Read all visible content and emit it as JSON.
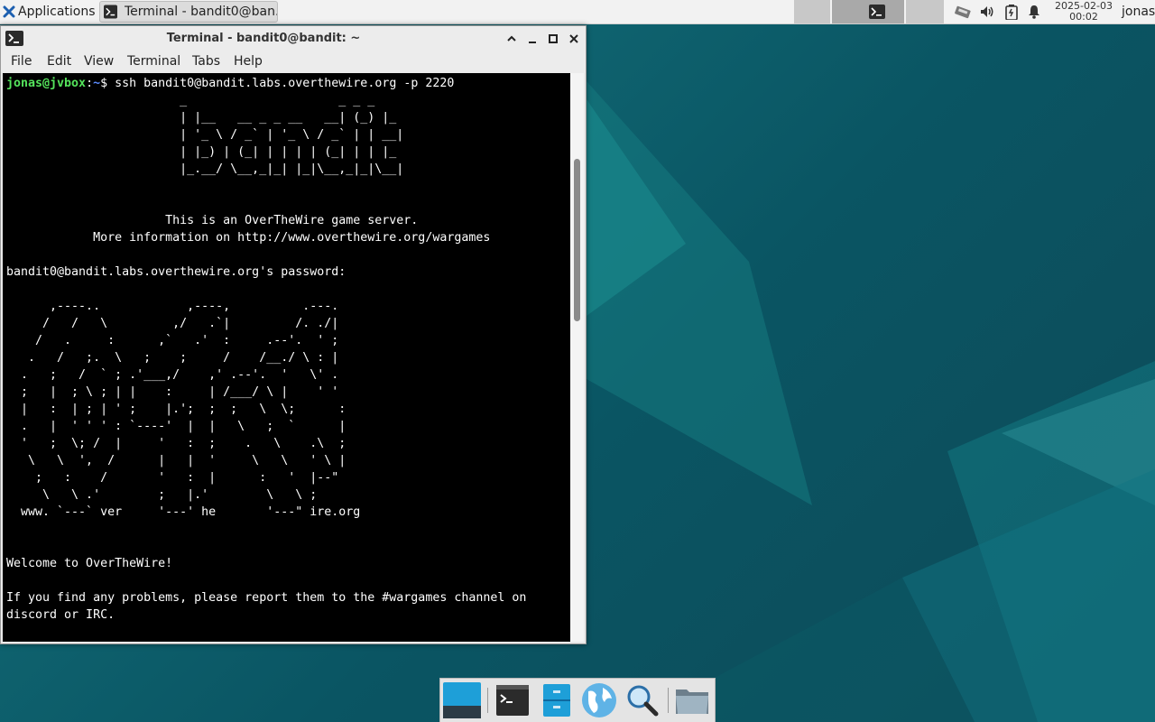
{
  "panel": {
    "applications_label": "Applications",
    "task_label": "Terminal - bandit0@ban...",
    "clock_date": "2025-02-03",
    "clock_time": "00:02",
    "user": "jonas"
  },
  "window": {
    "title": "Terminal - bandit0@bandit: ~",
    "menu": [
      "File",
      "Edit",
      "View",
      "Terminal",
      "Tabs",
      "Help"
    ]
  },
  "terminal": {
    "prompt_user": "jonas@jvbox",
    "prompt_path": "~",
    "prompt_symbol": "$",
    "command": "ssh bandit0@bandit.labs.overthewire.org -p 2220",
    "output": "                        _                     _ _ _\n                        | |__   __ _ _ __   __| (_) |_\n                        | '_ \\ / _` | '_ \\ / _` | | __|\n                        | |_) | (_| | | | | (_| | | |_\n                        |_.__/ \\__,_|_| |_|\\__,_|_|\\__|\n\n\n                      This is an OverTheWire game server.\n            More information on http://www.overthewire.org/wargames\n\nbandit0@bandit.labs.overthewire.org's password:\n\n      ,----..            ,----,          .---.\n     /   /   \\         ,/   .`|         /. ./|\n    /   .     :      ,`   .'  :     .--'.  ' ;\n   .   /   ;.  \\   ;    ;     /    /__./ \\ : |\n  .   ;   /  ` ; .'___,/    ,' .--'.  '   \\' .\n  ;   |  ; \\ ; | |    :     | /___/ \\ |    ' '\n  |   :  | ; | ' ;    |.';  ;  ;   \\  \\;      :\n  .   |  ' ' ' : `----'  |  |   \\   ;  `      |\n  '   ;  \\; /  |     '   :  ;    .   \\    .\\  ;\n   \\   \\  ',  /      |   |  '     \\   \\   ' \\ |\n    ;   :    /       '   :  |      :   '  |--\"\n     \\   \\ .'        ;   |.'        \\   \\ ;\n  www. `---` ver     '---' he       '---\" ire.org\n\n\nWelcome to OverTheWire!\n\nIf you find any problems, please report them to the #wargames channel on\ndiscord or IRC."
  },
  "icons": {
    "apps": "xfce-mouse-icon",
    "tray": [
      "network-icon",
      "volume-icon",
      "battery-icon",
      "notifications-icon"
    ],
    "dock": [
      "show-desktop-icon",
      "terminal-icon",
      "file-manager-icon",
      "web-browser-icon",
      "app-finder-icon",
      "folder-icon"
    ]
  },
  "colors": {
    "prompt_user": "#55e45c",
    "prompt_path": "#5c8cff",
    "desktop_bg": "#0f6470"
  }
}
